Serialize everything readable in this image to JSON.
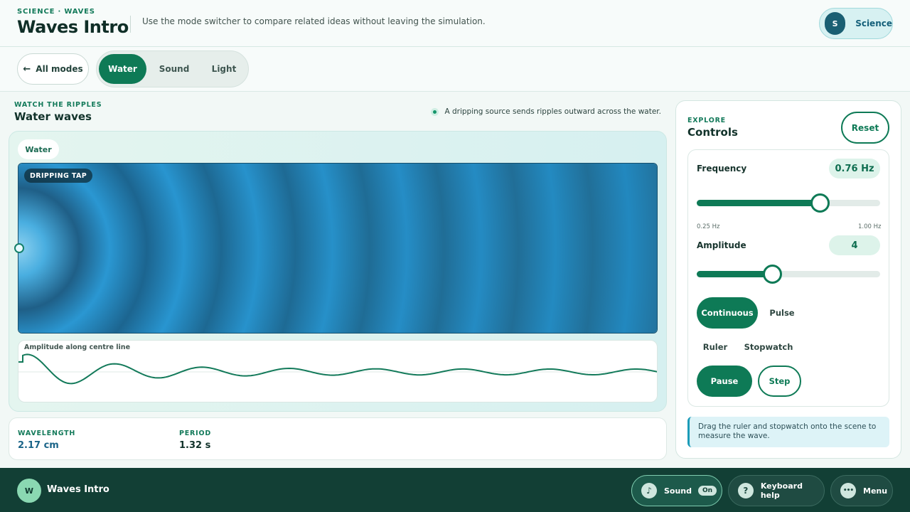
{
  "header": {
    "kicker": "SCIENCE · WAVES",
    "title": "Waves Intro",
    "description": "Use the mode switcher to compare related ideas without leaving the simulation.",
    "subject": {
      "initial": "S",
      "label": "Science"
    }
  },
  "modebar": {
    "all_modes_label": "All modes",
    "back_icon": "arrow-left-icon",
    "modes": [
      {
        "label": "Water",
        "active": true
      },
      {
        "label": "Sound",
        "active": false
      },
      {
        "label": "Light",
        "active": false
      }
    ]
  },
  "stage": {
    "kicker": "WATCH THE RIPPLES",
    "title": "Water waves",
    "note": "A dripping source sends ripples outward across the water.",
    "tag": "Water",
    "source_badge": "DRIPPING TAP",
    "graph_label": "Amplitude along centre line"
  },
  "metrics": [
    {
      "label": "WAVELENGTH",
      "value": "2.17 cm",
      "color": "#1a6488"
    },
    {
      "label": "PERIOD",
      "value": "1.32 s",
      "color": "#11322a"
    }
  ],
  "controls": {
    "kicker": "EXPLORE",
    "title": "Controls",
    "reset_label": "Reset",
    "frequency": {
      "label": "Frequency",
      "value": "0.76 Hz",
      "fraction": 0.67,
      "min_label": "0.25 Hz",
      "max_label": "1.00 Hz"
    },
    "amplitude": {
      "label": "Amplitude",
      "value": "4",
      "fraction": 0.41
    },
    "source_modes": [
      {
        "label": "Continuous",
        "active": true
      },
      {
        "label": "Pulse",
        "active": false
      }
    ],
    "tools": [
      {
        "label": "Ruler"
      },
      {
        "label": "Stopwatch"
      }
    ],
    "playback": [
      {
        "label": "Pause",
        "active": true
      },
      {
        "label": "Step",
        "active": false
      }
    ],
    "tip": "Drag the ruler and stopwatch onto the scene to measure the wave."
  },
  "footer": {
    "initial": "W",
    "title": "Waves Intro",
    "sound": {
      "label": "Sound",
      "state": "On",
      "icon": "music-note-icon"
    },
    "keyboard_help": {
      "label": "Keyboard help",
      "icon": "question-icon"
    },
    "menu": {
      "label": "Menu",
      "icon": "more-dots-icon"
    }
  },
  "colors": {
    "accent": "#0e7a56",
    "water_dark": "#1a5e88",
    "water_light": "#2f9bd6",
    "footer_bg": "#123f35"
  }
}
